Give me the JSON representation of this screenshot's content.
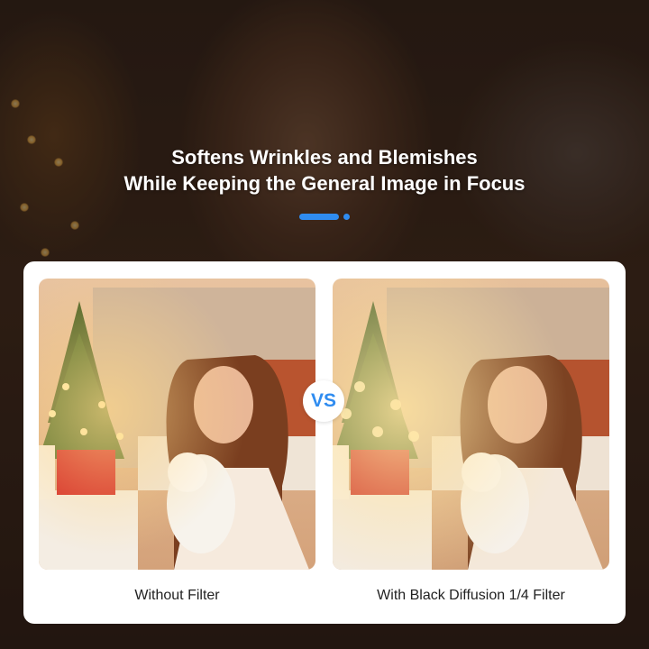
{
  "headline": {
    "line1": "Softens Wrinkles and Blemishes",
    "line2": "While Keeping the General Image in Focus"
  },
  "accent_color": "#2f8cf0",
  "comparison": {
    "vs_label": "VS",
    "left_caption": "Without Filter",
    "right_caption": "With Black Diffusion 1/4 Filter"
  }
}
